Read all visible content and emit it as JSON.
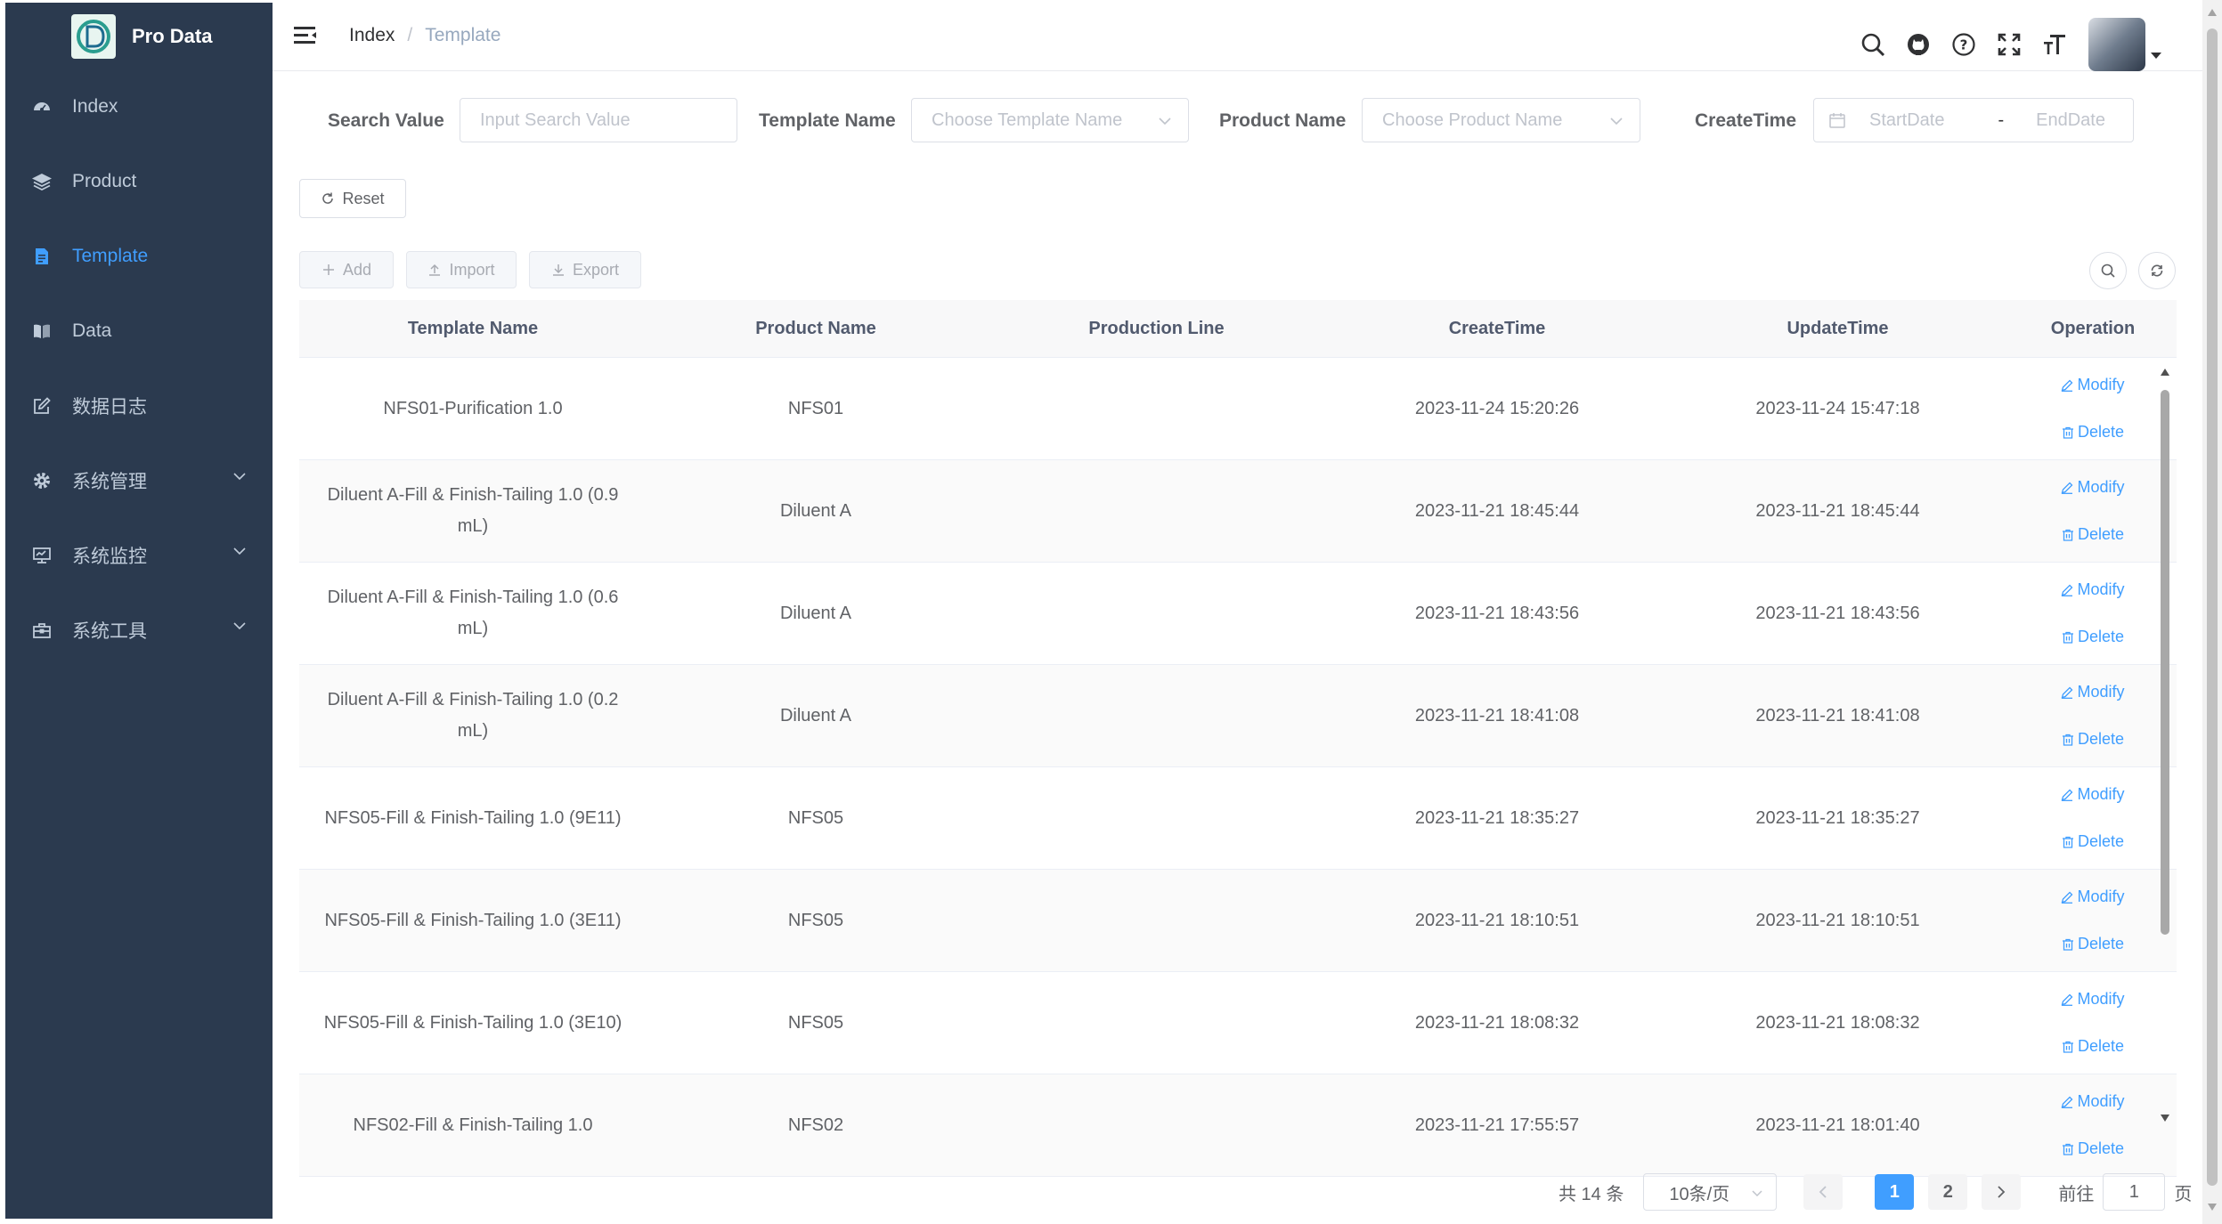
{
  "brand": {
    "name": "Pro Data"
  },
  "sidebar": {
    "items": [
      {
        "label": "Index",
        "icon": "dashboard-icon",
        "active": false,
        "has_submenu": false
      },
      {
        "label": "Product",
        "icon": "layers-icon",
        "active": false,
        "has_submenu": false
      },
      {
        "label": "Template",
        "icon": "document-icon",
        "active": true,
        "has_submenu": false
      },
      {
        "label": "Data",
        "icon": "book-icon",
        "active": false,
        "has_submenu": false
      },
      {
        "label": "数据日志",
        "icon": "edit-icon",
        "active": false,
        "has_submenu": false
      },
      {
        "label": "系统管理",
        "icon": "gear-icon",
        "active": false,
        "has_submenu": true
      },
      {
        "label": "系统监控",
        "icon": "monitor-icon",
        "active": false,
        "has_submenu": true
      },
      {
        "label": "系统工具",
        "icon": "toolbox-icon",
        "active": false,
        "has_submenu": true
      }
    ]
  },
  "header": {
    "breadcrumb": {
      "root": "Index",
      "separator": "/",
      "current": "Template"
    }
  },
  "filters": {
    "search_label": "Search Value",
    "search_placeholder": "Input Search Value",
    "template_label": "Template Name",
    "template_placeholder": "Choose Template Name",
    "product_label": "Product Name",
    "product_placeholder": "Choose Product Name",
    "createtime_label": "CreateTime",
    "start_placeholder": "StartDate",
    "range_separator": "-",
    "end_placeholder": "EndDate",
    "reset_label": "Reset"
  },
  "toolbar": {
    "add_label": "Add",
    "import_label": "Import",
    "export_label": "Export"
  },
  "table": {
    "columns": [
      "Template Name",
      "Product Name",
      "Production Line",
      "CreateTime",
      "UpdateTime",
      "Operation"
    ],
    "modify_label": "Modify",
    "delete_label": "Delete",
    "rows": [
      {
        "template_name": "NFS01-Purification 1.0",
        "product_name": "NFS01",
        "production_line": "",
        "create_time": "2023-11-24 15:20:26",
        "update_time": "2023-11-24 15:47:18"
      },
      {
        "template_name": "Diluent A-Fill & Finish-Tailing 1.0 (0.9 mL)",
        "product_name": "Diluent A",
        "production_line": "",
        "create_time": "2023-11-21 18:45:44",
        "update_time": "2023-11-21 18:45:44"
      },
      {
        "template_name": "Diluent A-Fill & Finish-Tailing 1.0 (0.6 mL)",
        "product_name": "Diluent A",
        "production_line": "",
        "create_time": "2023-11-21 18:43:56",
        "update_time": "2023-11-21 18:43:56"
      },
      {
        "template_name": "Diluent A-Fill & Finish-Tailing 1.0 (0.2 mL)",
        "product_name": "Diluent A",
        "production_line": "",
        "create_time": "2023-11-21 18:41:08",
        "update_time": "2023-11-21 18:41:08"
      },
      {
        "template_name": "NFS05-Fill & Finish-Tailing 1.0 (9E11)",
        "product_name": "NFS05",
        "production_line": "",
        "create_time": "2023-11-21 18:35:27",
        "update_time": "2023-11-21 18:35:27"
      },
      {
        "template_name": "NFS05-Fill & Finish-Tailing 1.0 (3E11)",
        "product_name": "NFS05",
        "production_line": "",
        "create_time": "2023-11-21 18:10:51",
        "update_time": "2023-11-21 18:10:51"
      },
      {
        "template_name": "NFS05-Fill & Finish-Tailing 1.0 (3E10)",
        "product_name": "NFS05",
        "production_line": "",
        "create_time": "2023-11-21 18:08:32",
        "update_time": "2023-11-21 18:08:32"
      },
      {
        "template_name": "NFS02-Fill & Finish-Tailing 1.0",
        "product_name": "NFS02",
        "production_line": "",
        "create_time": "2023-11-21 17:55:57",
        "update_time": "2023-11-21 18:01:40"
      }
    ]
  },
  "pagination": {
    "total_text": "共 14 条",
    "page_size": "10条/页",
    "pages": [
      "1",
      "2"
    ],
    "current_page": "1",
    "goto_label": "前往",
    "goto_value": "1",
    "goto_suffix": "页"
  },
  "colors": {
    "sidebar_bg": "#2b3a4f",
    "accent": "#409eff",
    "sidebar_text": "#bfcbd9"
  }
}
